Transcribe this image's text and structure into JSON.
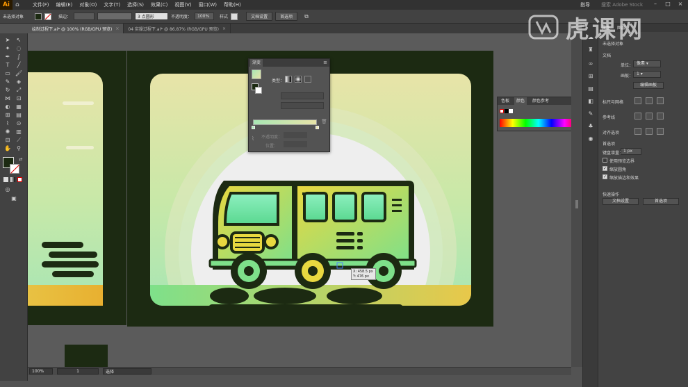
{
  "app": {
    "logo_text": "Ai"
  },
  "menu": {
    "items": [
      "文件(F)",
      "编辑(E)",
      "对象(O)",
      "文字(T)",
      "选择(S)",
      "效果(C)",
      "视图(V)",
      "窗口(W)",
      "帮助(H)"
    ],
    "workspace": "指导",
    "search_placeholder": "搜索 Adobe Stock"
  },
  "control_bar": {
    "selection_label": "未选择对象",
    "stroke_label": "描边：",
    "brush_label": "3 点圆形",
    "opacity_label": "不透明度：",
    "opacity_value": "100%",
    "style_label": "样式",
    "doc_setup_button": "文档设置",
    "prefs_button": "首选项"
  },
  "tabs": [
    {
      "label": "绘制过程下.ai* @ 100% (RGB/GPU 预览)",
      "close": "×"
    },
    {
      "label": "04 实操过程下.ai* @ 86.87% (RGB/GPU 预览)",
      "close": "×"
    }
  ],
  "status_bar": {
    "zoom": "100%",
    "page": "1",
    "tool_name": "选择"
  },
  "tooltip": {
    "x": "X: 458.5 px",
    "y": "Y: 476 px"
  },
  "gradient_panel": {
    "title": "渐变",
    "type_label": "类型：",
    "opacity_label": "不透明度：",
    "location_label": "位置："
  },
  "color_panel": {
    "tabs": [
      "色板",
      "颜色",
      "颜色参考"
    ]
  },
  "properties_panel": {
    "tabs": [
      "属性",
      "图层"
    ],
    "no_selection": "未选择对象",
    "section_document": "文档",
    "units_label": "单位：",
    "units_value": "像素",
    "artboard_label": "画板：",
    "artboard_value": "1",
    "edit_artboard_button": "编辑画板",
    "rulers_grids_label": "标尺与网格",
    "guides_label": "参考线",
    "snap_label": "对齐选项",
    "section_prefs": "首选项",
    "keyboard_increment_label": "键盘增量：",
    "keyboard_increment_value": "1 px",
    "use_preview_bounds": "使用预览边界",
    "scale_corners": "缩放圆角",
    "scale_strokes": "缩放描边和效果",
    "quick_actions": "快速操作",
    "doc_setup_button": "文档设置",
    "prefs_button": "首选项"
  },
  "watermark": {
    "text": "虎课网"
  },
  "colors": {
    "artboard_bg": "#1c2a12",
    "accent_green": "#7ee08a",
    "accent_yellow": "#e8c84a",
    "sky_top": "#e8e4a8",
    "sky_bottom": "#a8e6b4"
  }
}
